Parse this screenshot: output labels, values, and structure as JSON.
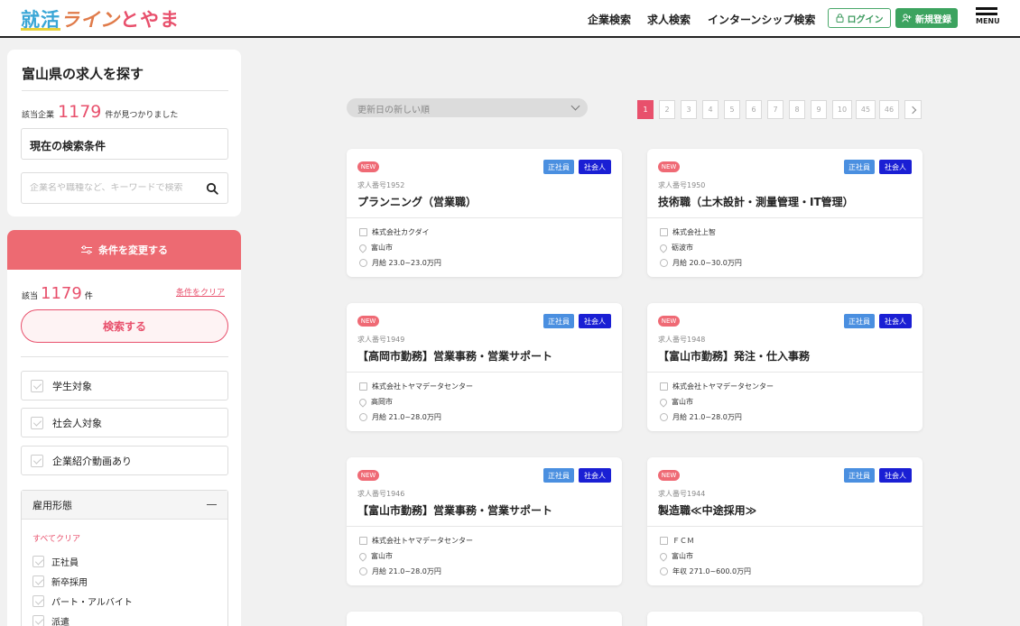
{
  "header": {
    "logo_parts": [
      "就活",
      "ライン",
      "とやま"
    ],
    "nav": [
      "企業検索",
      "求人検索",
      "インターンシップ検索"
    ],
    "login_label": "ログイン",
    "register_label": "新規登録",
    "menu_label": "MENU"
  },
  "sidebar": {
    "title": "富山県の求人を探す",
    "count_prefix": "該当企業",
    "count": "1179",
    "count_suffix": "件が見つかりました",
    "current_conditions": "現在の検索条件",
    "keyword_placeholder": "企業名や職種など、キーワードで検索",
    "change_conditions": "条件を変更する",
    "count2_prefix": "該当",
    "count2": "1179",
    "count2_suffix": "件",
    "clear_conditions": "条件をクリア",
    "search_button": "検索する",
    "checkboxes": [
      "学生対象",
      "社会人対象",
      "企業紹介動画あり"
    ],
    "employment": {
      "title": "雇用形態",
      "clear_all": "すべてクリア",
      "options": [
        "正社員",
        "新卒採用",
        "パート・アルバイト",
        "派遣"
      ]
    }
  },
  "main": {
    "sort_label": "更新日の新しい順",
    "pages": [
      "1",
      "2",
      "3",
      "4",
      "5",
      "6",
      "7",
      "8",
      "9",
      "10",
      "45",
      "46"
    ],
    "active_page": "1",
    "jobs": [
      {
        "badge": "NEW",
        "tags": [
          "正社員",
          "社会人"
        ],
        "job_no": "求人番号1952",
        "title": "プランニング（営業職）",
        "company": "株式会社カクダイ",
        "location": "富山市",
        "salary": "月給 23.0~23.0万円"
      },
      {
        "badge": "NEW",
        "tags": [
          "正社員",
          "社会人"
        ],
        "job_no": "求人番号1950",
        "title": "技術職（土木設計・測量管理・IT管理）",
        "company": "株式会社上智",
        "location": "砺波市",
        "salary": "月給 20.0~30.0万円"
      },
      {
        "badge": "NEW",
        "tags": [
          "正社員",
          "社会人"
        ],
        "job_no": "求人番号1949",
        "title": "【高岡市勤務】営業事務・営業サポート",
        "company": "株式会社トヤマデータセンター",
        "location": "高岡市",
        "salary": "月給 21.0~28.0万円"
      },
      {
        "badge": "NEW",
        "tags": [
          "正社員",
          "社会人"
        ],
        "job_no": "求人番号1948",
        "title": "【富山市勤務】発注・仕入事務",
        "company": "株式会社トヤマデータセンター",
        "location": "富山市",
        "salary": "月給 21.0~28.0万円"
      },
      {
        "badge": "NEW",
        "tags": [
          "正社員",
          "社会人"
        ],
        "job_no": "求人番号1946",
        "title": "【富山市勤務】営業事務・営業サポート",
        "company": "株式会社トヤマデータセンター",
        "location": "富山市",
        "salary": "月給 21.0~28.0万円"
      },
      {
        "badge": "NEW",
        "tags": [
          "正社員",
          "社会人"
        ],
        "job_no": "求人番号1944",
        "title": "製造職≪中途採用≫",
        "company": "ＦＣＭ",
        "location": "富山市",
        "salary": "年収 271.0~600.0万円"
      }
    ]
  }
}
